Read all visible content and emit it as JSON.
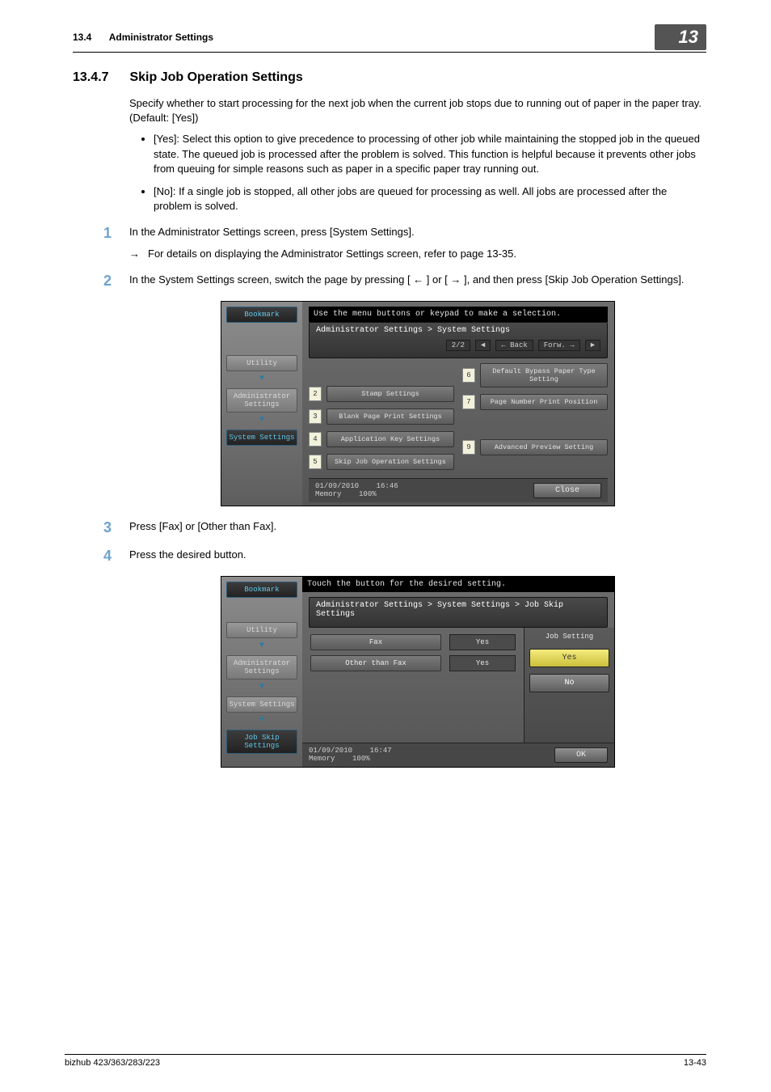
{
  "header": {
    "section_num": "13.4",
    "section_title": "Administrator Settings",
    "chapter": "13"
  },
  "heading": {
    "num": "13.4.7",
    "title": "Skip Job Operation Settings"
  },
  "intro": "Specify whether to start processing for the next job when the current job stops due to running out of paper in the paper tray. (Default: [Yes])",
  "bullets": [
    "[Yes]: Select this option to give precedence to processing of other job while maintaining the stopped job in the queued state. The queued job is processed after the problem is solved. This function is helpful because it prevents other jobs from queuing for simple reasons such as paper in a specific paper tray running out.",
    "[No]: If a single job is stopped, all other jobs are queued for processing as well. All jobs are processed after the problem is solved."
  ],
  "steps": [
    {
      "num": "1",
      "text": "In the Administrator Settings screen, press [System Settings].",
      "sub": "For details on displaying the Administrator Settings screen, refer to page 13-35."
    },
    {
      "num": "2",
      "text": "In the System Settings screen, switch the page by pressing [ ← ] or [ → ], and then press [Skip Job Operation Settings]."
    },
    {
      "num": "3",
      "text": "Press [Fax] or [Other than Fax]."
    },
    {
      "num": "4",
      "text": "Press the desired button."
    }
  ],
  "panel1": {
    "top": "Use the menu buttons or keypad to make a selection.",
    "bookmark": "Bookmark",
    "sidebar": {
      "utility": "Utility",
      "admin": "Administrator Settings",
      "system": "System Settings"
    },
    "crumb": "Administrator Settings > System Settings",
    "pager": {
      "page": "2/2",
      "back": "Back",
      "forw": "Forw."
    },
    "left_items": [
      {
        "n": "2",
        "label": "Stamp Settings"
      },
      {
        "n": "3",
        "label": "Blank Page Print Settings"
      },
      {
        "n": "4",
        "label": "Application Key Settings"
      },
      {
        "n": "5",
        "label": "Skip Job Operation Settings"
      }
    ],
    "right_items": [
      {
        "n": "6",
        "label": "Default Bypass Paper Type Setting"
      },
      {
        "n": "7",
        "label": "Page Number Print Position"
      },
      {
        "n": "",
        "label": ""
      },
      {
        "n": "9",
        "label": "Advanced Preview Setting"
      }
    ],
    "footer": {
      "date": "01/09/2010",
      "time": "16:46",
      "mem_label": "Memory",
      "mem_val": "100%",
      "close": "Close"
    }
  },
  "panel2": {
    "top": "Touch the button for the desired setting.",
    "bookmark": "Bookmark",
    "sidebar": {
      "utility": "Utility",
      "admin": "Administrator Settings",
      "system": "System Settings",
      "jobskip": "Job Skip Settings"
    },
    "crumb": "Administrator Settings > System Settings > Job Skip Settings",
    "rows": [
      {
        "label": "Fax",
        "value": "Yes"
      },
      {
        "label": "Other than Fax",
        "value": "Yes"
      }
    ],
    "right": {
      "label": "Job Setting",
      "yes": "Yes",
      "no": "No"
    },
    "footer": {
      "date": "01/09/2010",
      "time": "16:47",
      "mem_label": "Memory",
      "mem_val": "100%",
      "ok": "OK"
    }
  },
  "page_footer": {
    "left": "bizhub 423/363/283/223",
    "right": "13-43"
  }
}
